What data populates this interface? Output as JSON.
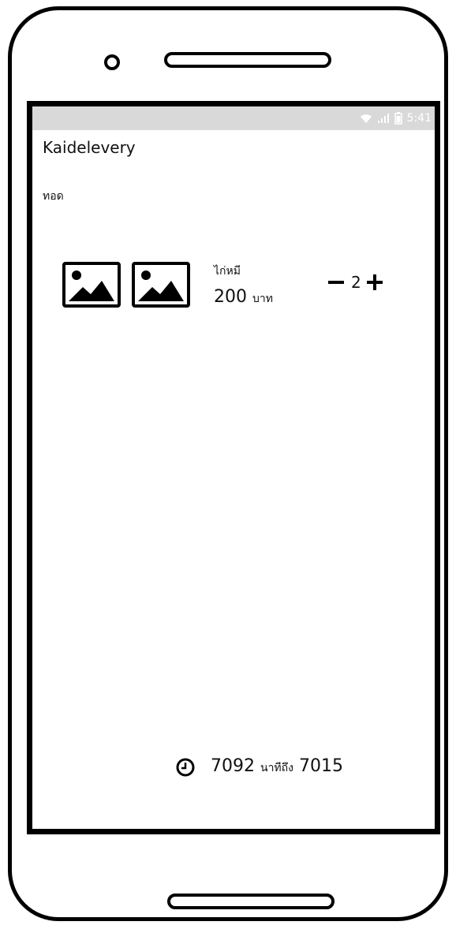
{
  "status_bar": {
    "time": "5:41",
    "icons": [
      "wifi-icon",
      "signal-icon",
      "battery-icon"
    ]
  },
  "app": {
    "title": "Kaidelevery"
  },
  "category": {
    "label": "ทอด"
  },
  "item": {
    "name": "ไก่หมี",
    "price": "200",
    "currency": "บาท",
    "quantity": "2",
    "images": [
      "image-placeholder-icon",
      "image-placeholder-icon"
    ]
  },
  "delivery": {
    "icon": "clock-icon",
    "from": "7092",
    "separator": "นาทีถึง",
    "to": "7015"
  },
  "colors": {
    "status_bar": "#d9d9d9",
    "outline": "#000000",
    "background": "#ffffff"
  }
}
